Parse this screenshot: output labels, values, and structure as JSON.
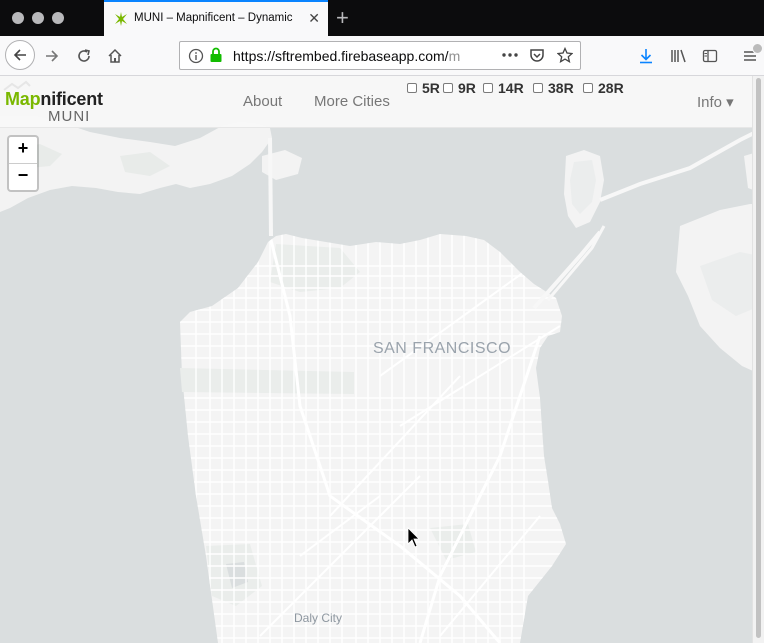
{
  "browser": {
    "tab_title": "MUNI – Mapnificent – Dynamic",
    "url_main": "https://sftrembed.firebaseapp.com/",
    "url_faded": "m",
    "new_tab_label": "+",
    "close_label": "✕"
  },
  "site": {
    "brand_prefix": "Map",
    "brand_suffix": "nificent",
    "brand_sub": "MUNI",
    "nav": {
      "about": "About",
      "more_cities": "More Cities",
      "info": "Info ▾"
    },
    "routes": [
      {
        "label": "5R",
        "checked": false
      },
      {
        "label": "9R",
        "checked": false
      },
      {
        "label": "14R",
        "checked": false
      },
      {
        "label": "38R",
        "checked": false
      },
      {
        "label": "28R",
        "checked": false
      }
    ]
  },
  "map": {
    "zoom_in": "+",
    "zoom_out": "−",
    "labels": {
      "city": "SAN FRANCISCO",
      "daly_city": "Daly City"
    },
    "colors": {
      "water": "#dadedf",
      "land": "#f4f4f4",
      "streets": "#ffffff",
      "park": "#e9ecea",
      "label": "#9aa3ac"
    }
  }
}
